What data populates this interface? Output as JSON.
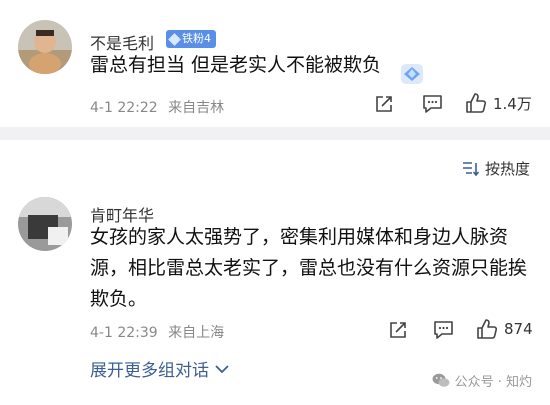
{
  "comments": [
    {
      "username": "不是毛利",
      "badge": "铁粉4",
      "text": "雷总有担当 但是老实人不能被欺负",
      "time": "4-1 22:22",
      "location": "来自吉林",
      "likes": "1.4万",
      "avatar_icon": "user-avatar-photo",
      "sticker_icon": "diamond-sticker-icon"
    },
    {
      "username": "肯町年华",
      "text_lines": [
        "女孩的家人太强势了，密集利用媒体和身边人脉资",
        "源，相比雷总太老实了，雷总也没有什么资源只能挨",
        "欺负。"
      ],
      "time": "4-1 22:39",
      "location": "来自上海",
      "likes": "874",
      "avatar_icon": "user-avatar-photo"
    }
  ],
  "sort": {
    "label": "按热度",
    "icon": "sort-icon"
  },
  "expand": {
    "label": "展开更多组对话",
    "icon": "chevron-down-icon"
  },
  "watermark": {
    "label": "公众号 · 知灼",
    "icon": "wechat-icon"
  },
  "colors": {
    "link": "#3b5f93",
    "badge": "#5a8fe8",
    "divider": "#f1f1f3"
  }
}
